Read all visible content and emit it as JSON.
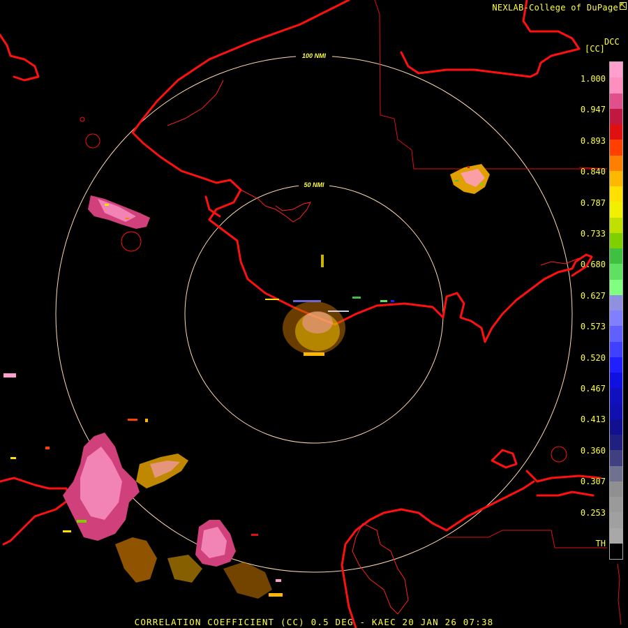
{
  "credit": "NEXLAB-College of DuPage",
  "credit_icon": "cursor-arrow-icon",
  "product_code": "DCC",
  "units": "[CC]",
  "legend": {
    "labels": [
      "1.000",
      "0.947",
      "0.893",
      "0.840",
      "0.787",
      "0.733",
      "0.680",
      "0.627",
      "0.573",
      "0.520",
      "0.467",
      "0.413",
      "0.360",
      "0.307",
      "0.253",
      "TH"
    ],
    "colors": [
      "#ff9fce",
      "#ff8fbf",
      "#e0508a",
      "#c01840",
      "#e01010",
      "#ff4000",
      "#ff8000",
      "#ffb800",
      "#ffe000",
      "#f0f000",
      "#c0e000",
      "#80d000",
      "#40c040",
      "#60e060",
      "#80ff80",
      "#9090e0",
      "#8080ff",
      "#6060ff",
      "#4040ff",
      "#2020ff",
      "#1010e0",
      "#1010c0",
      "#1010b0",
      "#101090",
      "#202080",
      "#404080",
      "#707090",
      "#909090",
      "#9a9a9a",
      "#a0a0a0",
      "#a8a8a8",
      "#000000"
    ]
  },
  "rings": [
    {
      "label": "50 NMI"
    },
    {
      "label": "100 NMI"
    }
  ],
  "footer": "CORRELATION COEFFICIENT (CC) 0.5 DEG - KAEC 20 JAN 26 07:38",
  "colors": {
    "background": "#000000",
    "coastline": "#ff1010",
    "border": "#e01010",
    "range_ring": "#ffd9b0",
    "text": "#ffff40"
  }
}
